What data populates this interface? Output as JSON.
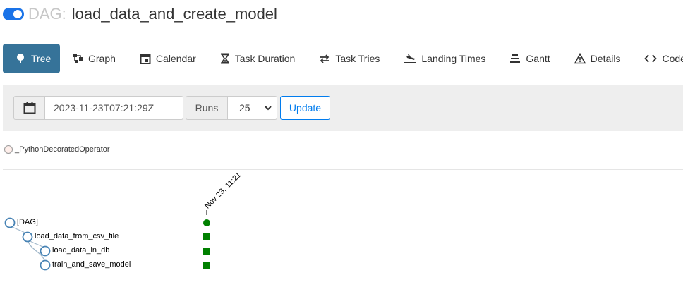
{
  "header": {
    "prefix": "DAG:",
    "dag_id": "load_data_and_create_model",
    "toggle_state": "on"
  },
  "nav": {
    "tabs": [
      {
        "label": "Tree",
        "icon": "tree-icon",
        "active": true
      },
      {
        "label": "Graph",
        "icon": "graph-icon",
        "active": false
      },
      {
        "label": "Calendar",
        "icon": "calendar-icon",
        "active": false
      },
      {
        "label": "Task Duration",
        "icon": "hourglass-icon",
        "active": false
      },
      {
        "label": "Task Tries",
        "icon": "repeat-icon",
        "active": false
      },
      {
        "label": "Landing Times",
        "icon": "landing-icon",
        "active": false
      },
      {
        "label": "Gantt",
        "icon": "gantt-icon",
        "active": false
      },
      {
        "label": "Details",
        "icon": "warning-triangle-icon",
        "active": false
      },
      {
        "label": "Code",
        "icon": "code-icon",
        "active": false
      }
    ]
  },
  "filters": {
    "base_date": "2023-11-23T07:21:29Z",
    "runs_label": "Runs",
    "runs_value": "25",
    "update_label": "Update"
  },
  "legend": {
    "operator": "_PythonDecoratedOperator"
  },
  "tree": {
    "run_date": "Nov 23, 11:21",
    "nodes": [
      {
        "label": "[DAG]",
        "depth": 0,
        "status": "success",
        "status_shape": "circle"
      },
      {
        "label": "load_data_from_csv_file",
        "depth": 1,
        "status": "success",
        "status_shape": "square"
      },
      {
        "label": "load_data_in_db",
        "depth": 2,
        "status": "success",
        "status_shape": "square"
      },
      {
        "label": "train_and_save_model",
        "depth": 2,
        "status": "success",
        "status_shape": "square"
      }
    ]
  },
  "colors": {
    "accent": "#367399",
    "toggle": "#1a73e8",
    "update_button": "#017cee",
    "success": "#008000",
    "node_stroke": "#4682b4",
    "operator_fill": "#ffefeb"
  }
}
